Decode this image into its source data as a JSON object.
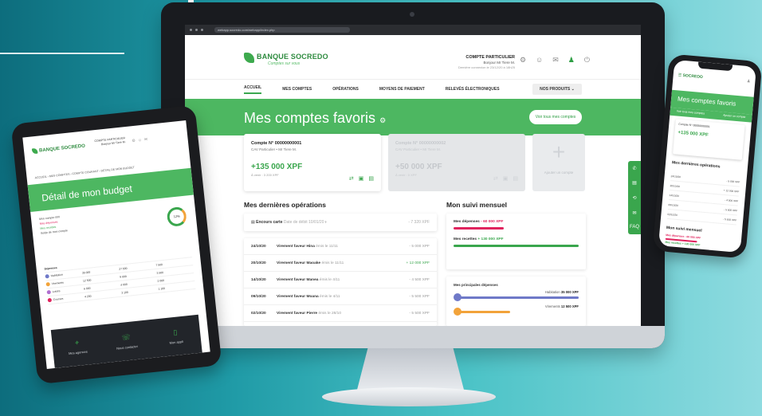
{
  "monitor": {
    "url": "webapp.socredo.com/webapp/index.php",
    "brand": {
      "name": "BANQUE SOCREDO",
      "tagline": "Comptes sur vous"
    },
    "account": {
      "title": "COMPTE PARTICULIER",
      "greeting": "Bonjour Mr Tiere M.",
      "last_login": "Dernière connexion le 23/12/20 à 18h25"
    },
    "nav": [
      "ACCUEIL",
      "MES COMPTES",
      "OPÉRATIONS",
      "MOYENS DE PAIEMENT",
      "RELEVÉS ÉLECTRONIQUES"
    ],
    "products_button": "NOS PRODUITS",
    "hero": {
      "title": "Mes comptes favoris",
      "button": "Voir tous mes comptes"
    },
    "cards": [
      {
        "number": "Compte N° 00000000001",
        "owner": "CAV Particulier • Mr Tiere M.",
        "balance": "+135 000 XPF",
        "sub": "À venir : 3 200 XPF"
      },
      {
        "number": "Compte N° 00000000002",
        "owner": "CAV Particulier • Mr Tiere M.",
        "balance": "+50 000 XPF",
        "sub": "À venir : 0 XPF"
      }
    ],
    "add_card_label": "Ajouter un compte",
    "ops_title": "Mes dernières opérations",
    "encours": {
      "label": "Encours carte",
      "detail": "Date de débit 10/01/20",
      "amount": "- 7 320 XPF"
    },
    "operations": [
      {
        "date": "24/10/20",
        "label": "Virement faveur Hina",
        "detail": "émis le 11/11",
        "amount": "- 5 000 XPF",
        "positive": false
      },
      {
        "date": "20/10/20",
        "label": "Virement faveur Maoake",
        "detail": "émis le 11/11",
        "amount": "+ 12 000 XPF",
        "positive": true
      },
      {
        "date": "14/10/20",
        "label": "Virement faveur Manea",
        "detail": "émis le 4/11",
        "amount": "- 4 500 XPF",
        "positive": false
      },
      {
        "date": "09/10/20",
        "label": "Virement faveur Moana",
        "detail": "émis le 4/11",
        "amount": "- 5 500 XPF",
        "positive": false
      },
      {
        "date": "02/10/20",
        "label": "Virement faveur Pierre",
        "detail": "émis le 28/10",
        "amount": "- 5 500 XPF",
        "positive": false
      }
    ],
    "suivi_title": "Mon suivi mensuel",
    "suivi": {
      "expenses_label": "Mes dépenses",
      "expenses_value": "- 60 000 XPF",
      "income_label": "Mes recettes",
      "income_value": "+ 130 000 XPF"
    },
    "top_expenses_title": "Mes principales dépenses",
    "top_expenses": [
      {
        "label": "Habitation",
        "value": "35 000 XPF",
        "color": "#6f79c8",
        "fill": 1.0
      },
      {
        "label": "Virements",
        "value": "12 500 XPF",
        "color": "#f2a33a",
        "fill": 0.45
      }
    ],
    "side_tab": [
      "✆",
      "▤",
      "⟲",
      "✉",
      "FAQ"
    ],
    "colors": {
      "green": "#4db761",
      "red": "#e0245e",
      "orange": "#f2a33a",
      "violet": "#6f79c8"
    }
  },
  "tablet": {
    "brand": "BANQUE SOCREDO",
    "account": "COMPTE PARTICULIER Bonjour Mr Tiere M.",
    "nav": "ACCUEIL › MES COMPTES › COMPTE COURANT › DÉTAIL DE MON BUDGET",
    "hero": "Détail de mon budget",
    "info": [
      "Mon compte 000",
      "Mes dépenses",
      "Mes recettes",
      "Solde de mon compte"
    ],
    "ring": "12%",
    "table_title": "Dépenses",
    "table": [
      {
        "label": "Habitation",
        "a": "35 000",
        "b": "27 500",
        "c": "7 500"
      },
      {
        "label": "Virements",
        "a": "12 500",
        "b": "9 000",
        "c": "3 500"
      },
      {
        "label": "Loisirs",
        "a": "6 000",
        "b": "4 000",
        "c": "2 000"
      },
      {
        "label": "Courses",
        "a": "4 200",
        "b": "3 100",
        "c": "1 100"
      }
    ],
    "tiles": [
      {
        "icon": "⌖",
        "label": "Mes agences"
      },
      {
        "icon": "☏",
        "label": "Nous contacter"
      },
      {
        "icon": "▯",
        "label": "Mon appli"
      }
    ]
  },
  "phone": {
    "brand": "SOCREDO",
    "hero": "Mes comptes favoris",
    "links": [
      "Voir tous mes comptes",
      "Ajouter un compte"
    ],
    "card": {
      "number": "Compte N° 00000000001",
      "balance": "+135 000 XPF"
    },
    "ops_title": "Mes dernières opérations",
    "rows": [
      {
        "date": "24/10/20",
        "amount": "- 5 000 XPF"
      },
      {
        "date": "20/10/20",
        "amount": "+ 12 000 XPF"
      },
      {
        "date": "14/10/20",
        "amount": "- 4 500 XPF"
      },
      {
        "date": "09/10/20",
        "amount": "- 5 500 XPF"
      },
      {
        "date": "02/10/20",
        "amount": "- 5 500 XPF"
      }
    ],
    "suivi_title": "Mon suivi mensuel",
    "suivi_lines": [
      "Mes dépenses - 60 000 XPF",
      "Mes recettes + 130 000 XPF"
    ]
  }
}
